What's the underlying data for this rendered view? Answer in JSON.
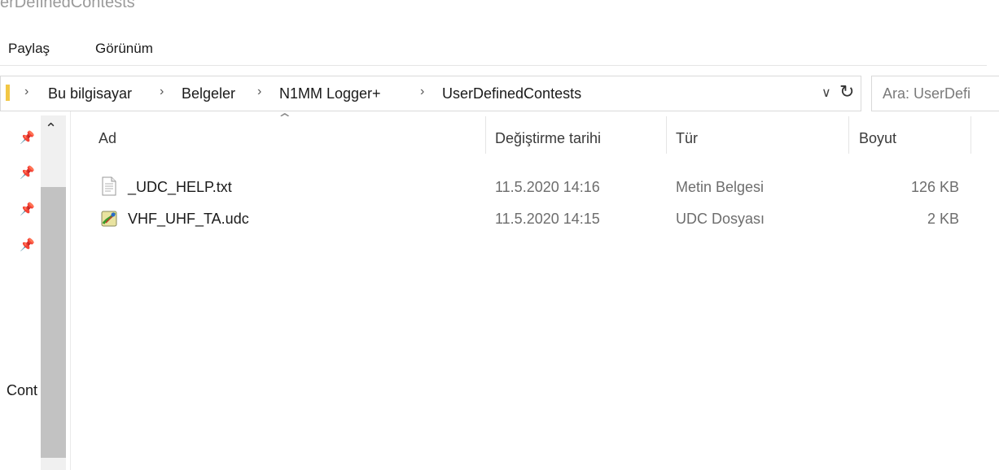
{
  "window": {
    "title_fragment": "erDefinedContests"
  },
  "ribbon": {
    "tabs": [
      "Paylaş",
      "Görünüm"
    ]
  },
  "address": {
    "crumbs": [
      "Bu bilgisayar",
      "Belgeler",
      "N1MM Logger+",
      "UserDefinedContests"
    ],
    "separator": "›",
    "dropdown_icon": "chevron-down-icon",
    "refresh_icon": "refresh-icon"
  },
  "search": {
    "placeholder": "Ara: UserDefi"
  },
  "nav": {
    "partial_label": "Cont"
  },
  "columns": {
    "name": "Ad",
    "date": "Değiştirme tarihi",
    "type": "Tür",
    "size": "Boyut"
  },
  "files": [
    {
      "name": "_UDC_HELP.txt",
      "date": "11.5.2020 14:16",
      "type": "Metin Belgesi",
      "size": "126 KB",
      "icon": "text-file-icon"
    },
    {
      "name": "VHF_UHF_TA.udc",
      "date": "11.5.2020 14:15",
      "type": "UDC Dosyası",
      "size": "2 KB",
      "icon": "udc-file-icon"
    }
  ],
  "colors": {
    "accent": "#f2c744",
    "muted_text": "#6d6d6d",
    "scroll_thumb": "#c2c2c2"
  }
}
